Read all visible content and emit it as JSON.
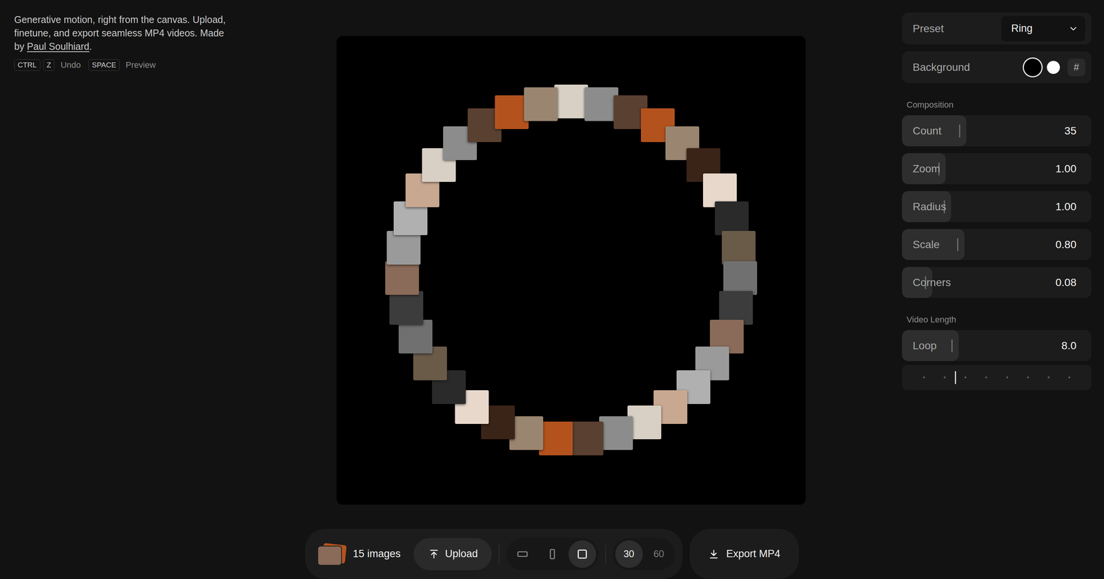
{
  "intro": {
    "text": "Generative motion, right from the canvas. Upload, finetune, and export seamless MP4 videos. Made by ",
    "link": "Paul Soulhiard",
    "suffix": "."
  },
  "shortcuts": [
    {
      "keys": [
        "CTRL",
        "Z"
      ],
      "label": "Undo"
    },
    {
      "keys": [
        "SPACE"
      ],
      "label": "Preview"
    }
  ],
  "images": [
    {
      "color": "#d8d0c4"
    },
    {
      "color": "#8c8c8c"
    },
    {
      "color": "#5a4030"
    },
    {
      "color": "#b4521e"
    },
    {
      "color": "#9a8570"
    },
    {
      "color": "#3a2418"
    },
    {
      "color": "#e8d8cc"
    },
    {
      "color": "#2a2a2a"
    },
    {
      "color": "#6a5a48"
    },
    {
      "color": "#707070"
    },
    {
      "color": "#3c3c3c"
    },
    {
      "color": "#8a6a58"
    },
    {
      "color": "#9a9a9a"
    },
    {
      "color": "#b0b0b0"
    },
    {
      "color": "#c8a890"
    }
  ],
  "panel": {
    "preset": {
      "label": "Preset",
      "value": "Ring"
    },
    "background": {
      "label": "Background",
      "swatches": [
        {
          "color": "#000000",
          "selected": true
        },
        {
          "color": "#ffffff",
          "selected": false
        }
      ],
      "custom": "#"
    },
    "sections": [
      {
        "title": "Composition",
        "sliders": [
          {
            "label": "Count",
            "value": "35",
            "level": 0.34
          },
          {
            "label": "Zoom",
            "value": "1.00",
            "level": 0.23
          },
          {
            "label": "Radius",
            "value": "1.00",
            "level": 0.26
          },
          {
            "label": "Scale",
            "value": "0.80",
            "level": 0.33
          },
          {
            "label": "Corners",
            "value": "0.08",
            "level": 0.16
          }
        ]
      },
      {
        "title": "Video Length",
        "sliders": [
          {
            "label": "Loop",
            "value": "8.0",
            "level": 0.3
          }
        ]
      }
    ],
    "timeline": {
      "level": 0.28
    }
  },
  "toolbar": {
    "images_label": "15 images",
    "upload": "Upload",
    "aspects": [
      {
        "kind": "landscape",
        "selected": false
      },
      {
        "kind": "portrait",
        "selected": false
      },
      {
        "kind": "square",
        "selected": true
      }
    ],
    "fps": [
      {
        "label": "30",
        "selected": true
      },
      {
        "label": "60",
        "selected": false
      }
    ],
    "export": "Export MP4"
  }
}
